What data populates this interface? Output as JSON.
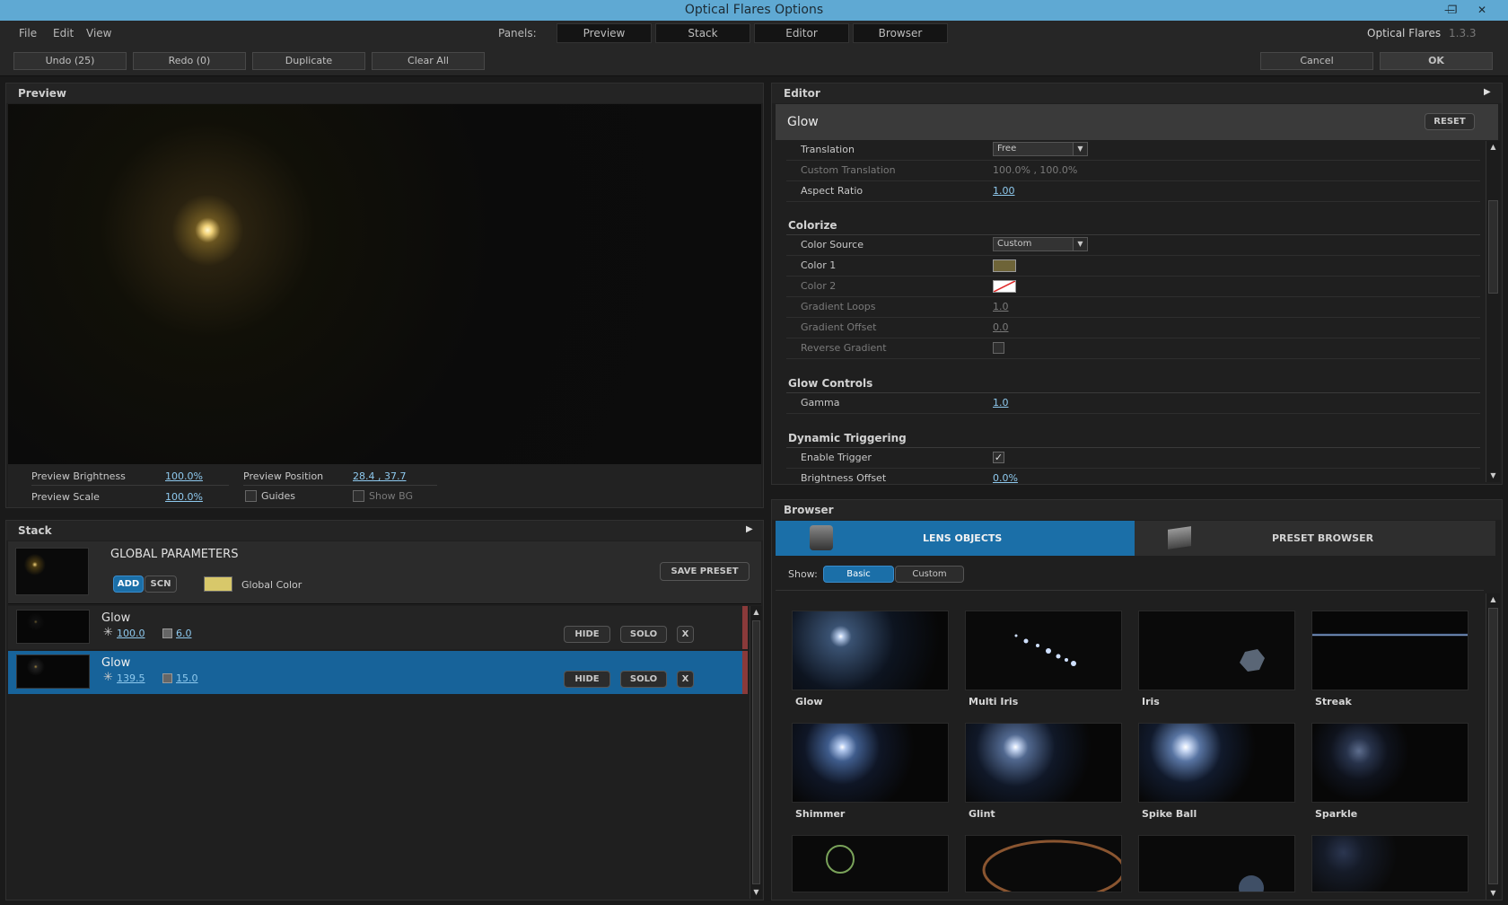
{
  "window": {
    "title": "Optical Flares Options"
  },
  "menu": {
    "items": [
      "File",
      "Edit",
      "View"
    ],
    "panels_label": "Panels:",
    "panel_tabs": [
      "Preview",
      "Stack",
      "Editor",
      "Browser"
    ],
    "app_name": "Optical Flares",
    "version": "1.3.3"
  },
  "toolbar": {
    "undo": "Undo (25)",
    "redo": "Redo (0)",
    "duplicate": "Duplicate",
    "clear_all": "Clear All",
    "cancel": "Cancel",
    "ok": "OK"
  },
  "preview": {
    "title": "Preview",
    "brightness_label": "Preview Brightness",
    "brightness_value": "100.0%",
    "scale_label": "Preview Scale",
    "scale_value": "100.0%",
    "position_label": "Preview Position",
    "position_value": "28.4 , 37.7",
    "guides_label": "Guides",
    "show_bg_label": "Show BG"
  },
  "stack": {
    "title": "Stack",
    "global": {
      "title": "GLOBAL PARAMETERS",
      "add": "ADD",
      "scn": "SCN",
      "color_label": "Global Color",
      "save_preset": "SAVE PRESET",
      "color": "#d8c86a"
    },
    "items": [
      {
        "name": "Glow",
        "brightness": "100.0",
        "scale": "6.0",
        "hide": "HIDE",
        "solo": "SOLO",
        "remove": "X"
      },
      {
        "name": "Glow",
        "brightness": "139.5",
        "scale": "15.0",
        "hide": "HIDE",
        "solo": "SOLO",
        "remove": "X"
      }
    ]
  },
  "editor": {
    "title": "Editor",
    "object_name": "Glow",
    "reset": "RESET",
    "rows_top": [
      {
        "label": "Translation",
        "value": "Free",
        "type": "dropdown"
      },
      {
        "label": "Custom Translation",
        "value": "100.0% , 100.0%",
        "type": "dim"
      },
      {
        "label": "Aspect Ratio",
        "value": "1.00",
        "type": "link"
      }
    ],
    "colorize": {
      "title": "Colorize",
      "color_source_label": "Color Source",
      "color_source_value": "Custom",
      "color1_label": "Color 1",
      "color1": "#6e6438",
      "color2_label": "Color 2",
      "gradient_loops_label": "Gradient Loops",
      "gradient_loops_value": "1.0",
      "gradient_offset_label": "Gradient Offset",
      "gradient_offset_value": "0.0",
      "reverse_gradient_label": "Reverse Gradient"
    },
    "glow_controls": {
      "title": "Glow Controls",
      "gamma_label": "Gamma",
      "gamma_value": "1.0"
    },
    "dynamic": {
      "title": "Dynamic Triggering",
      "enable_label": "Enable Trigger",
      "brightness_offset_label": "Brightness Offset",
      "brightness_offset_value": "0.0%"
    }
  },
  "browser": {
    "title": "Browser",
    "tabs": [
      "LENS OBJECTS",
      "PRESET BROWSER"
    ],
    "show_label": "Show:",
    "filters": [
      "Basic",
      "Custom"
    ],
    "items": [
      "Glow",
      "Multi Iris",
      "Iris",
      "Streak",
      "Shimmer",
      "Glint",
      "Spike Ball",
      "Sparkle"
    ]
  },
  "colors": {
    "accent": "#1b6fa8",
    "selected_row": "#17639a"
  }
}
